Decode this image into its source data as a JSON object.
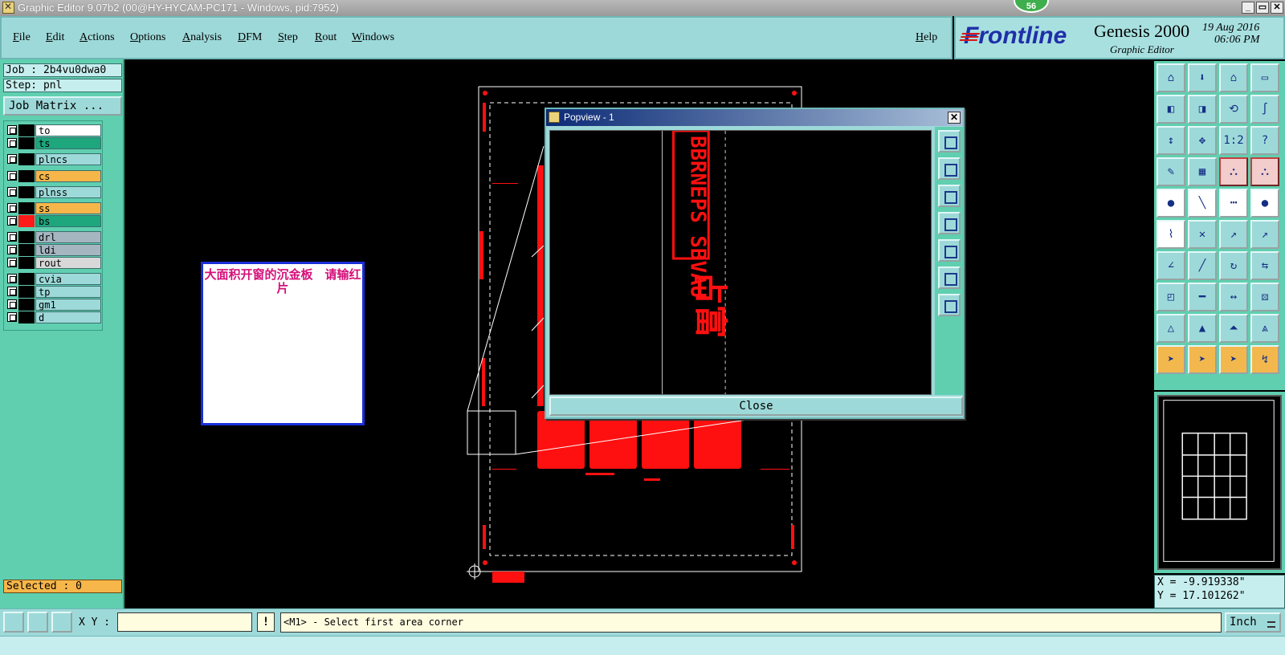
{
  "window": {
    "title": "Graphic Editor 9.07b2 (00@HY-HYCAM-PC171 - Windows, pid:7952)",
    "badge": "56",
    "controls": [
      "_",
      "▭",
      "✕"
    ]
  },
  "menu": [
    "File",
    "Edit",
    "Actions",
    "Options",
    "Analysis",
    "DFM",
    "Step",
    "Rout",
    "Windows"
  ],
  "help": "Help",
  "brand": {
    "logo": "Frontline",
    "product": "Genesis 2000",
    "subtitle": "Graphic Editor",
    "date": "19 Aug 2016",
    "time": "06:06 PM"
  },
  "left_panel": {
    "job": "Job : 2b4vu0dwa0",
    "step": "Step: pnl",
    "job_matrix_button": "Job Matrix ...",
    "layers": [
      {
        "name": "to",
        "color": "#ffffff",
        "swatch": "#000000"
      },
      {
        "name": "ts",
        "color": "#1ea67d",
        "swatch": "#000000"
      },
      {
        "name": "plncs",
        "color": "#9ed9d9",
        "swatch": "#000000"
      },
      {
        "name": "cs",
        "color": "#f7b64a",
        "swatch": "#000000"
      },
      {
        "name": "plnss",
        "color": "#9ed9d9",
        "swatch": "#000000"
      },
      {
        "name": "ss",
        "color": "#f7b64a",
        "swatch": "#000000"
      },
      {
        "name": "bs",
        "color": "#1ea67d",
        "swatch": "#ff1a1a"
      },
      {
        "name": "drl",
        "color": "#a6b6c1",
        "swatch": "#000000"
      },
      {
        "name": "ldi",
        "color": "#a6b6c1",
        "swatch": "#000000"
      },
      {
        "name": "rout",
        "color": "#d8d8d8",
        "swatch": "#000000"
      },
      {
        "name": "cvia",
        "color": "#9ed9d9",
        "swatch": "#000000"
      },
      {
        "name": "tp",
        "color": "#9ed9d9",
        "swatch": "#000000"
      },
      {
        "name": "gm1",
        "color": "#9ed9d9",
        "swatch": "#000000"
      },
      {
        "name": "d",
        "color": "#9ed9d9",
        "swatch": "#000000"
      }
    ],
    "selected": "Selected : 0"
  },
  "note": {
    "text": "大面积开窗的沉金板　请输红片",
    "color": "#d4107a"
  },
  "popview": {
    "title": "Popview - 1",
    "close_x": "✕",
    "close_button": "Close",
    "vertical_text": "BBRNEPS SBVAU"
  },
  "right_toolbar": {
    "icons": [
      "zoom-home-icon",
      "zoom-page-icon",
      "house-icon",
      "split-view-icon",
      "pan-left-icon",
      "pan-right-icon",
      "snap-icon",
      "curve-icon",
      "fit-height-icon",
      "fit-all-icon",
      "ratio-icon",
      "help-icon",
      "measure-tool-icon",
      "grid-icon",
      "net-highlight-icon",
      "net-select-icon",
      "pad-add-icon",
      "line-add-icon",
      "ruler-icon",
      "dot-icon",
      "connect-icon",
      "cross-icon",
      "move-point-icon",
      "stretch-icon",
      "angle-icon",
      "line-edit-icon",
      "rotate-icon",
      "mirror-icon",
      "pad-move-icon",
      "split-line-icon",
      "fit-width-icon",
      "cluster-icon",
      "arc-up-icon",
      "arc-mid-icon",
      "arc-full-icon",
      "arc-cut-icon",
      "select-arrow-icon",
      "select-box-icon",
      "select-pad-icon",
      "select-path-icon"
    ],
    "ratio_label": "1:2",
    "help_label": "?"
  },
  "minimap": {
    "label": ""
  },
  "coords": {
    "x": "X = -9.919338\"",
    "y": "Y = 17.101262\""
  },
  "bottom": {
    "xy_label": "X Y :",
    "xy_value": "",
    "prompt": "<M1> - Select first area corner",
    "units": "Inch",
    "warn": "!"
  }
}
